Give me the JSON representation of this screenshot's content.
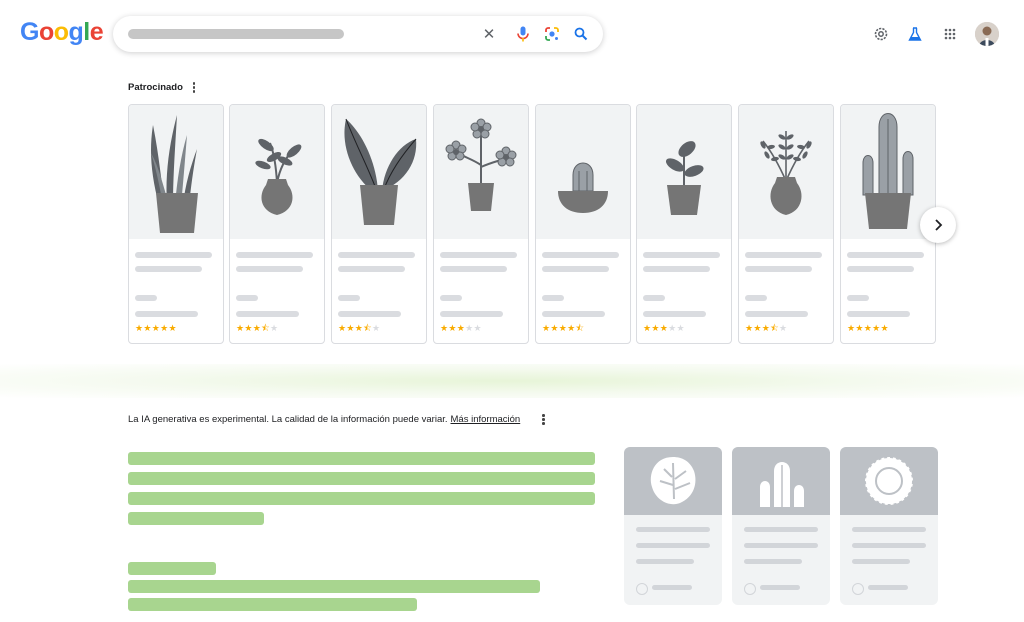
{
  "logo": {
    "letters": [
      "G",
      "o",
      "o",
      "g",
      "l",
      "e"
    ],
    "colors": [
      "#4285F4",
      "#EA4335",
      "#FBBC05",
      "#4285F4",
      "#34A853",
      "#EA4335"
    ]
  },
  "search": {
    "icons": [
      "clear-icon",
      "microphone-icon",
      "google-lens-icon",
      "search-icon"
    ],
    "clear_glyph": "✕"
  },
  "header_icons": [
    "settings-icon",
    "labs-flask-icon",
    "apps-grid-icon",
    "account-avatar"
  ],
  "sponsored": {
    "label": "Patrocinado"
  },
  "products": [
    {
      "plant": "snake-plant",
      "rating": 5
    },
    {
      "plant": "small-leaf-plant",
      "rating": 3.5
    },
    {
      "plant": "large-leaf-plant",
      "rating": 3.5
    },
    {
      "plant": "flower-plant",
      "rating": 3
    },
    {
      "plant": "cactus-bowl",
      "rating": 4.5
    },
    {
      "plant": "succulent",
      "rating": 3
    },
    {
      "plant": "fern",
      "rating": 3.5
    },
    {
      "plant": "tall-cactus",
      "rating": 5
    }
  ],
  "carousel_next": {
    "icon": "chevron-right-icon"
  },
  "ai": {
    "disclaimer": "La IA generativa es experimental. La calidad de la información puede variar.",
    "link": "Más información"
  },
  "ai_cards": [
    {
      "image": "monstera-leaf-icon"
    },
    {
      "image": "cactus-icon"
    },
    {
      "image": "sunflower-icon"
    }
  ],
  "colors": {
    "star": "#f9ab00",
    "skeleton": "#dadce0",
    "ai_bar": "#a8d58f",
    "accent_blue": "#1a73e8"
  }
}
